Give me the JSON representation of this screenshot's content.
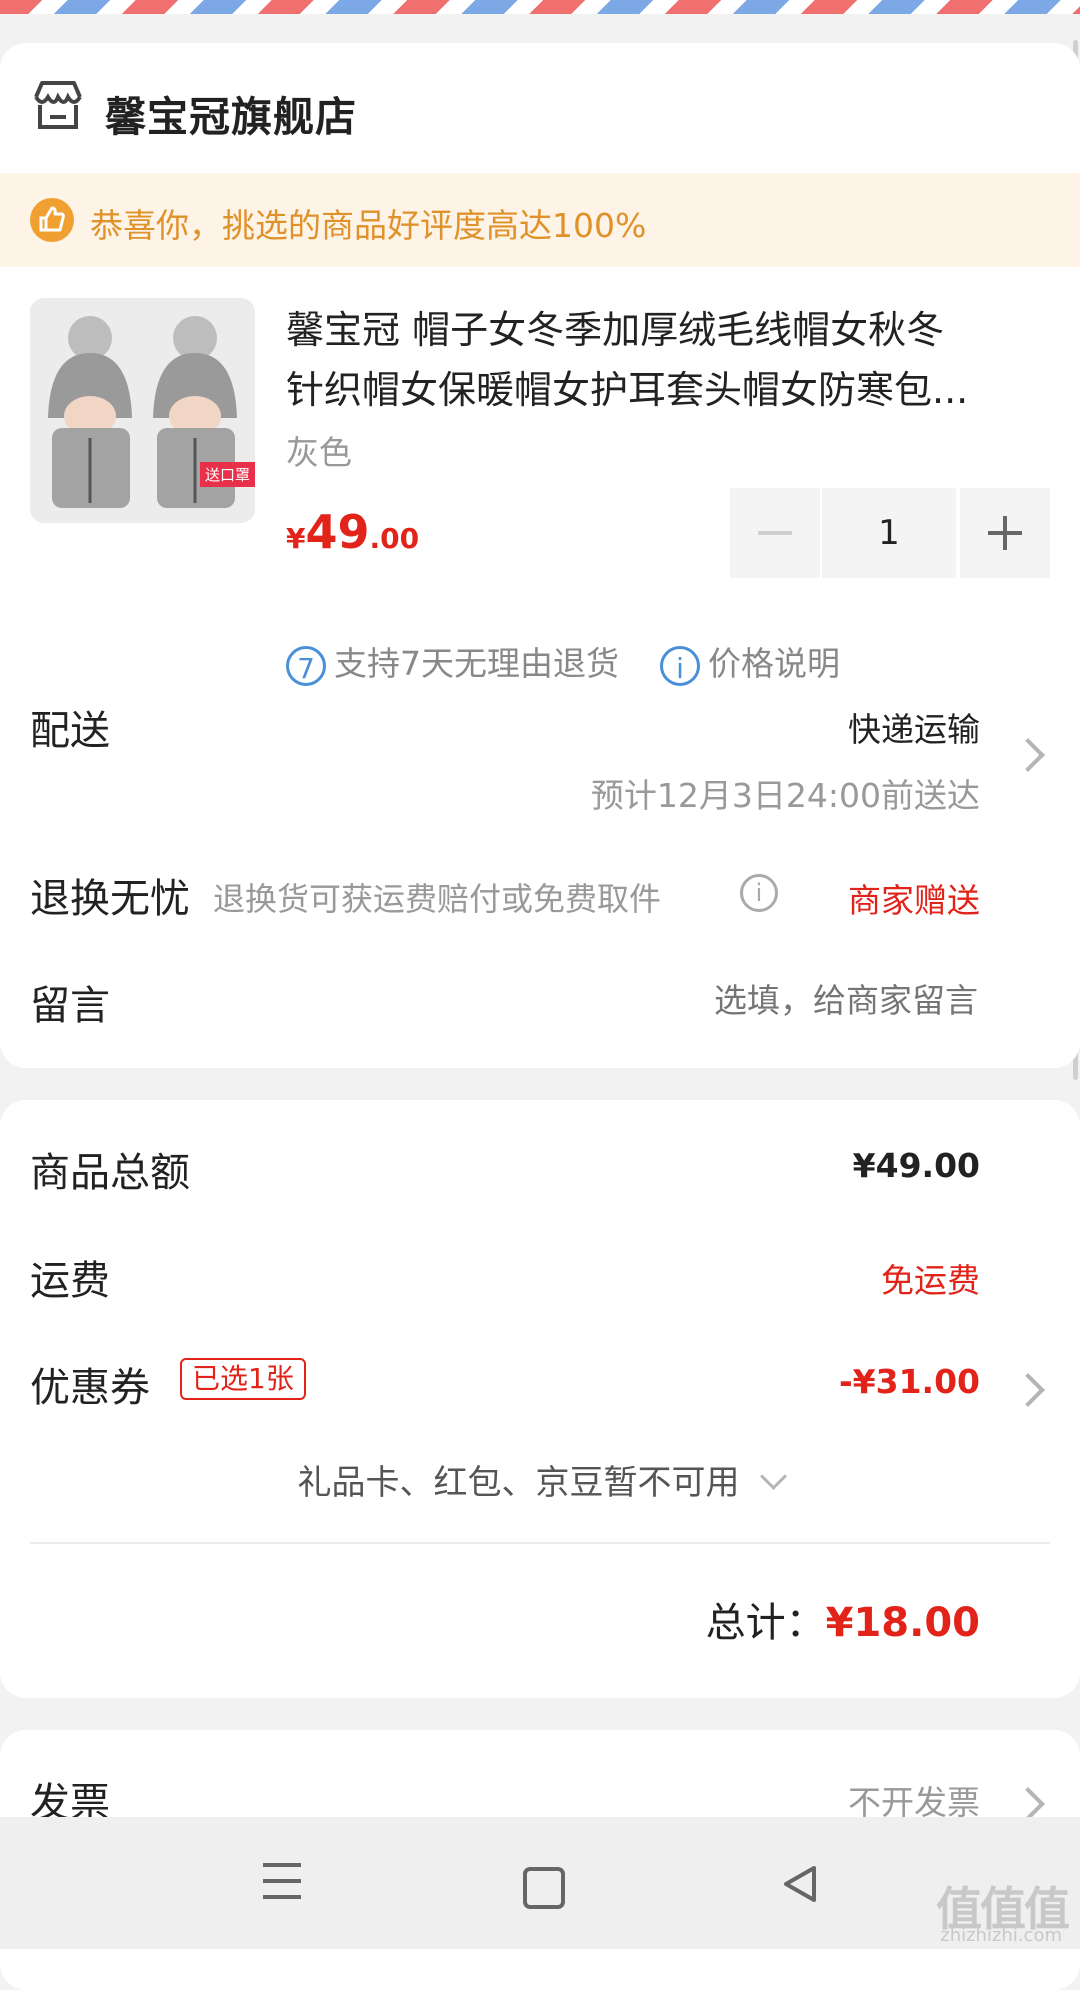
{
  "store": {
    "name": "馨宝冠旗舰店",
    "icon": "store-icon"
  },
  "praise": {
    "text": "恭喜你，挑选的商品好评度高达100%",
    "icon": "thumbs-up-icon"
  },
  "product": {
    "title_line1": "馨宝冠 帽子女冬季加厚绒毛线帽女秋冬",
    "title_line2": "针织帽女保暖帽女护耳套头帽女防寒包...",
    "variant": "灰色",
    "image_tag": "送口罩",
    "price_currency": "¥",
    "price_int": "49",
    "price_dec": ".00",
    "quantity": "1"
  },
  "services": [
    {
      "icon_text": "7",
      "label": "支持7天无理由退货"
    },
    {
      "icon_text": "i",
      "label": "价格说明"
    }
  ],
  "delivery": {
    "label": "配送",
    "method": "快递运输",
    "eta": "预计12月3日24:00前送达"
  },
  "return": {
    "label": "退换无忧",
    "desc": "退换货可获运费赔付或免费取件",
    "value": "商家赠送"
  },
  "message": {
    "label": "留言",
    "placeholder": "选填，给商家留言"
  },
  "summary": {
    "goods_label": "商品总额",
    "goods_value": "¥49.00",
    "shipping_label": "运费",
    "shipping_value": "免运费",
    "coupon_label": "优惠券",
    "coupon_badge": "已选1张",
    "coupon_value": "-¥31.00",
    "unavailable": "礼品卡、红包、京豆暂不可用",
    "total_label": "总计：",
    "total_value": "¥18.00"
  },
  "invoice": {
    "label": "发票",
    "value": "不开发票"
  },
  "watermark": {
    "text": "值值值",
    "sub": "zhizhizhi.com"
  },
  "colors": {
    "accent_red": "#e2231a",
    "praise_orange": "#e0922a",
    "info_blue": "#4a90d9"
  }
}
